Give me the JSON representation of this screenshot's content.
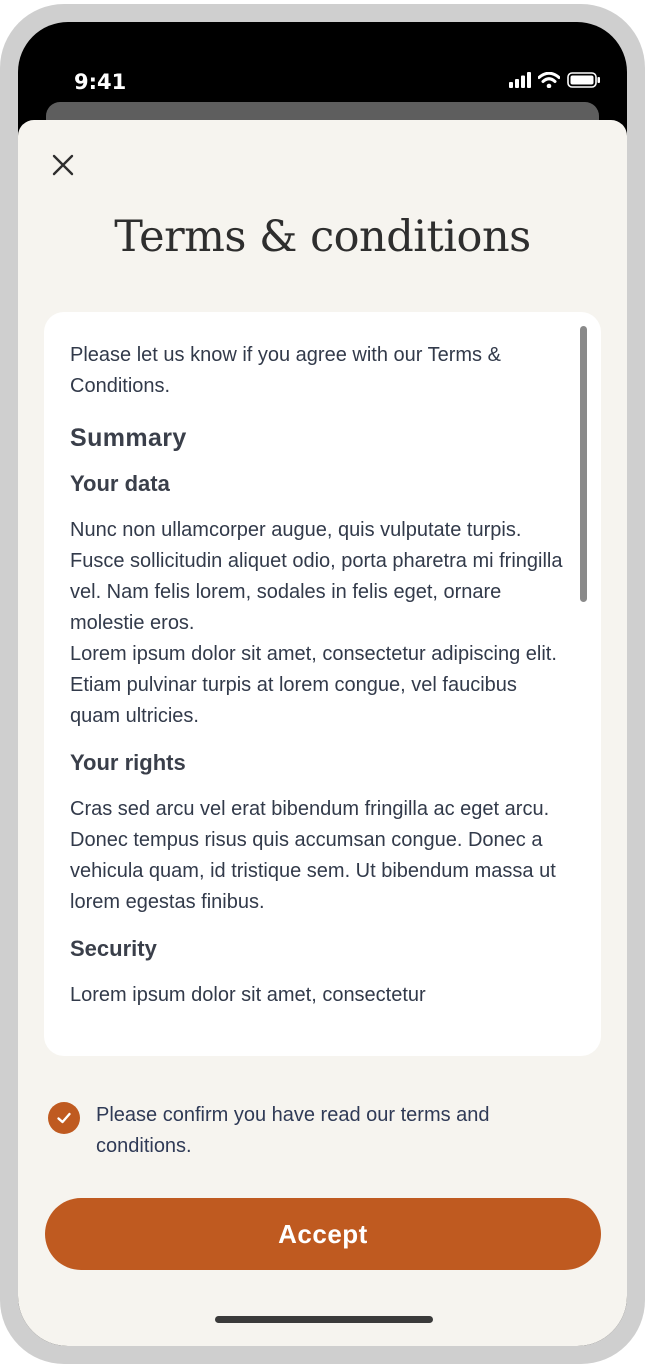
{
  "status_bar": {
    "time": "9:41"
  },
  "header": {
    "title": "Terms & conditions"
  },
  "terms": {
    "intro": "Please let us know if you agree with our Terms & Conditions.",
    "summary_heading": "Summary",
    "your_data_heading": "Your data",
    "your_data_p1": "Nunc non ullamcorper augue, quis vulputate turpis.  Fusce sollicitudin aliquet odio, porta pharetra mi fringilla vel. Nam felis lorem, sodales in felis eget, ornare molestie eros.",
    "your_data_p2": "Lorem ipsum dolor sit amet, consectetur adipiscing elit. Etiam pulvinar turpis at lorem congue, vel faucibus quam ultricies.",
    "your_rights_heading": "Your rights",
    "your_rights_p": "Cras sed arcu vel erat bibendum fringilla ac eget arcu. Donec tempus risus quis accumsan congue. Donec a vehicula quam, id tristique sem. Ut bibendum massa ut lorem egestas finibus.",
    "security_heading": "Security",
    "security_p": "Lorem ipsum dolor sit amet, consectetur"
  },
  "confirm": {
    "checked": true,
    "label": "Please confirm you have read our terms and conditions."
  },
  "actions": {
    "accept_label": "Accept"
  },
  "colors": {
    "accent": "#bf5a20",
    "sheet_background": "#f6f4ef",
    "card_background": "#ffffff",
    "text": "#323a4a"
  },
  "icons": {
    "close": "close-icon",
    "check": "check-icon",
    "signal": "signal-icon",
    "wifi": "wifi-icon",
    "battery": "battery-icon"
  }
}
